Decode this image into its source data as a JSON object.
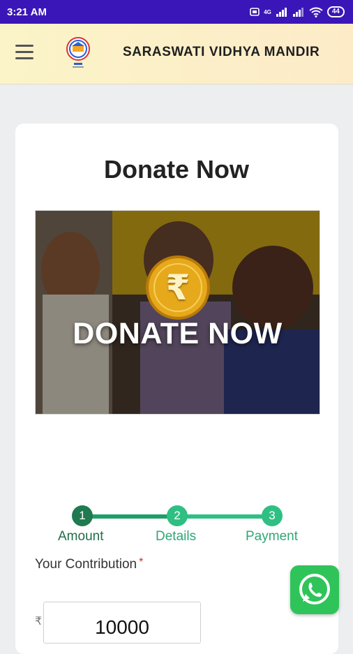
{
  "status_bar": {
    "time": "3:21 AM",
    "network_label": "4G",
    "battery": "44"
  },
  "header": {
    "title": "SARASWATI VIDHYA MANDIR",
    "logo_icon": "school-logo"
  },
  "main": {
    "heading": "Donate Now",
    "banner": {
      "text": "DONATE NOW",
      "coin_symbol": "₹"
    },
    "steps": [
      {
        "number": "1",
        "label": "Amount"
      },
      {
        "number": "2",
        "label": "Details"
      },
      {
        "number": "3",
        "label": "Payment"
      }
    ],
    "contribution": {
      "label": "Your Contribution",
      "required_mark": "*",
      "currency": "₹",
      "value": "10000"
    }
  },
  "colors": {
    "status_bar": "#3a16b8",
    "step_active": "#1f7a4f",
    "step_inactive": "#2fbf83",
    "whatsapp": "#2fc45a"
  }
}
